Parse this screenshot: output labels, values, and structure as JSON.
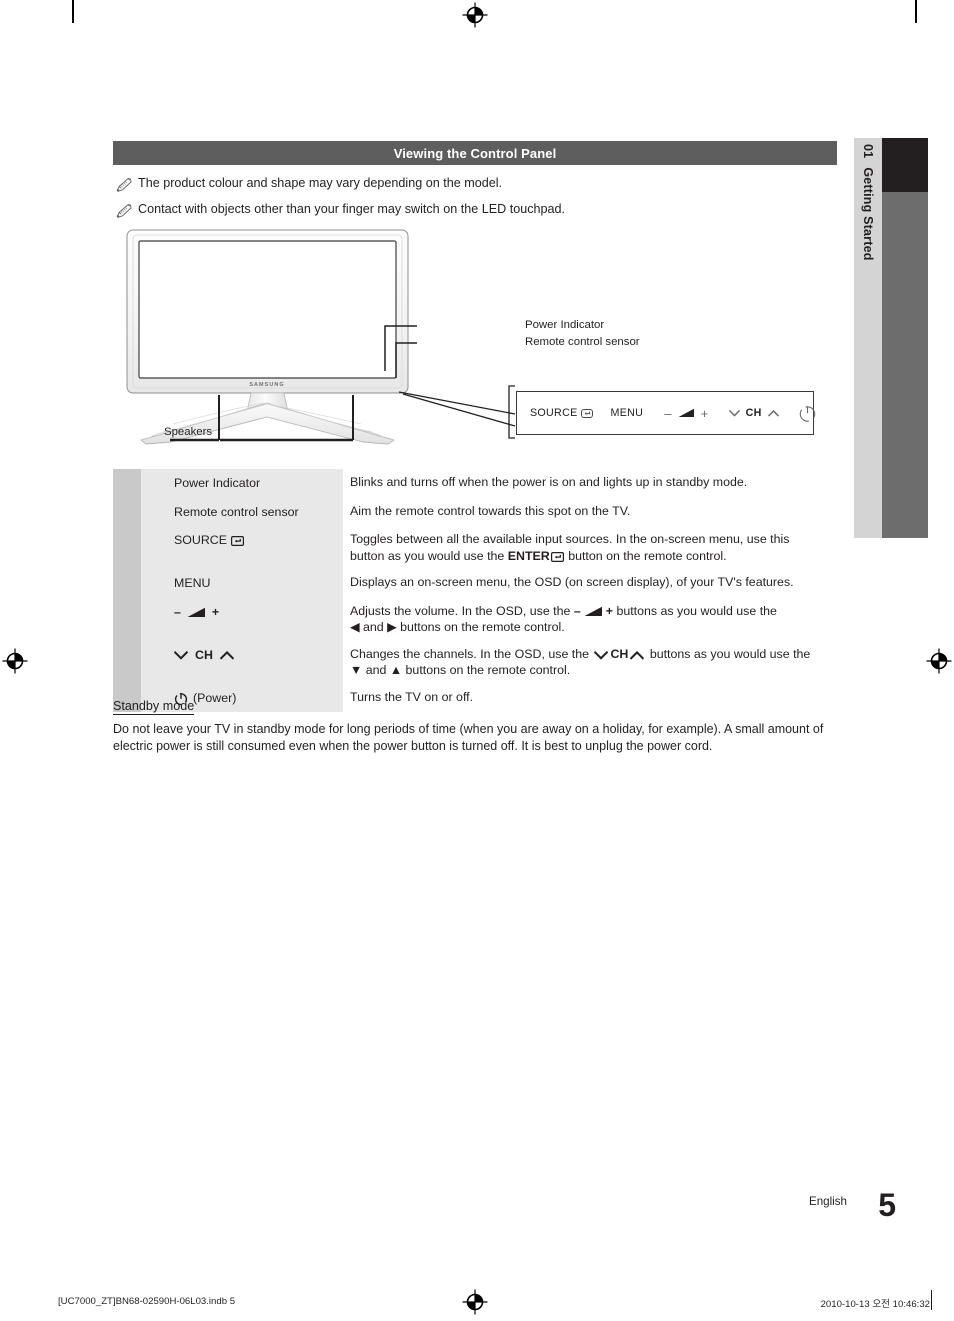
{
  "side_tab": {
    "chapter_number": "01",
    "chapter_title": "Getting Started"
  },
  "section": {
    "heading": "Viewing the Control Panel"
  },
  "notes": [
    {
      "icon": "pencil-note-icon",
      "text": "The product colour and shape may vary depending on the model."
    },
    {
      "icon": "pencil-note-icon",
      "text": "Contact with objects other than your finger may switch on the LED touchpad."
    }
  ],
  "figure": {
    "brand_logo": "SAMSUNG",
    "callouts": {
      "power_indicator": "Power Indicator",
      "remote_control_sensor": "Remote control sensor",
      "speakers": "Speakers"
    },
    "control_panel": {
      "source_label": "SOURCE",
      "source_icon": "enter-return-icon",
      "menu_label": "MENU",
      "volume_minus": "–",
      "volume_icon": "volume-wedge-icon",
      "volume_plus": "+",
      "channel_down_icon": "chevron-down-icon",
      "channel_label": "CH",
      "channel_up_icon": "chevron-up-icon",
      "power_icon": "power-symbol-icon"
    }
  },
  "spec_table": {
    "rows": [
      {
        "label": "Power Indicator",
        "label_icon": null,
        "description": "Blinks and turns off when the power is on and lights up in standby mode.",
        "desc_line2": null
      },
      {
        "label": "Remote control sensor",
        "label_icon": null,
        "description": "Aim the remote control towards this spot on the TV.",
        "desc_line2": null
      },
      {
        "label": "SOURCE",
        "label_icon": "enter-return-icon",
        "description": "Toggles between all the available input sources. In the on-screen menu, use this",
        "desc_line2_pre": "button as you would use the ",
        "desc_line2_strong": "ENTER",
        "desc_line2_icon": "enter-return-icon",
        "desc_line2_post": " button on the remote control."
      },
      {
        "label": "MENU",
        "label_icon": null,
        "description": "Displays an on-screen menu, the OSD (on screen display), of your TV's features.",
        "desc_line2": null
      },
      {
        "label_minus": "–",
        "label_icon": "volume-wedge-icon",
        "label_plus": "+",
        "desc_pre": "Adjusts the volume. In the OSD, use the ",
        "desc_minus": "–",
        "desc_icon": "volume-wedge-icon",
        "desc_plus": "+",
        "desc_post": " buttons as you would use the",
        "desc_line2_left": "◀",
        "desc_line2_mid": " and ",
        "desc_line2_right": "▶",
        "desc_line2_tail": " buttons on the remote control."
      },
      {
        "label_down_icon": "chevron-down-icon",
        "label": "CH",
        "label_up_icon": "chevron-up-icon",
        "desc_pre": "Changes the channels. In the OSD, use the ",
        "desc_down_icon": "chevron-down-icon",
        "desc_ch": "CH",
        "desc_up_icon": "chevron-up-icon",
        "desc_post": " buttons as you would use the",
        "desc_line2_left": "▼",
        "desc_line2_mid": " and ",
        "desc_line2_right": "▲",
        "desc_line2_tail": " buttons on the remote control."
      },
      {
        "label_icon": "power-symbol-icon",
        "label": "(Power)",
        "description": "Turns the TV on or off.",
        "desc_line2": null
      }
    ]
  },
  "standby": {
    "heading": "Standby mode",
    "body": "Do not leave your TV in standby mode for long periods of time (when you are away on a holiday, for example). A small amount of electric power is still consumed even when the power button is turned off. It is best to unplug the power cord."
  },
  "footer": {
    "language": "English",
    "page_number": "5",
    "imprint_left": "[UC7000_ZT]BN68-02590H-06L03.indb   5",
    "imprint_right": "2010-10-13   오전 10:46:32"
  },
  "colors": {
    "section_bar": "#5e5e5e",
    "tab_strip": "#d4d4d4",
    "tab_block_dark": "#231f20",
    "tab_block_gray": "#6d6d6d",
    "row_swatch": "#c9c9c9",
    "row_label": "#e8e8e8",
    "text": "#231f20"
  }
}
